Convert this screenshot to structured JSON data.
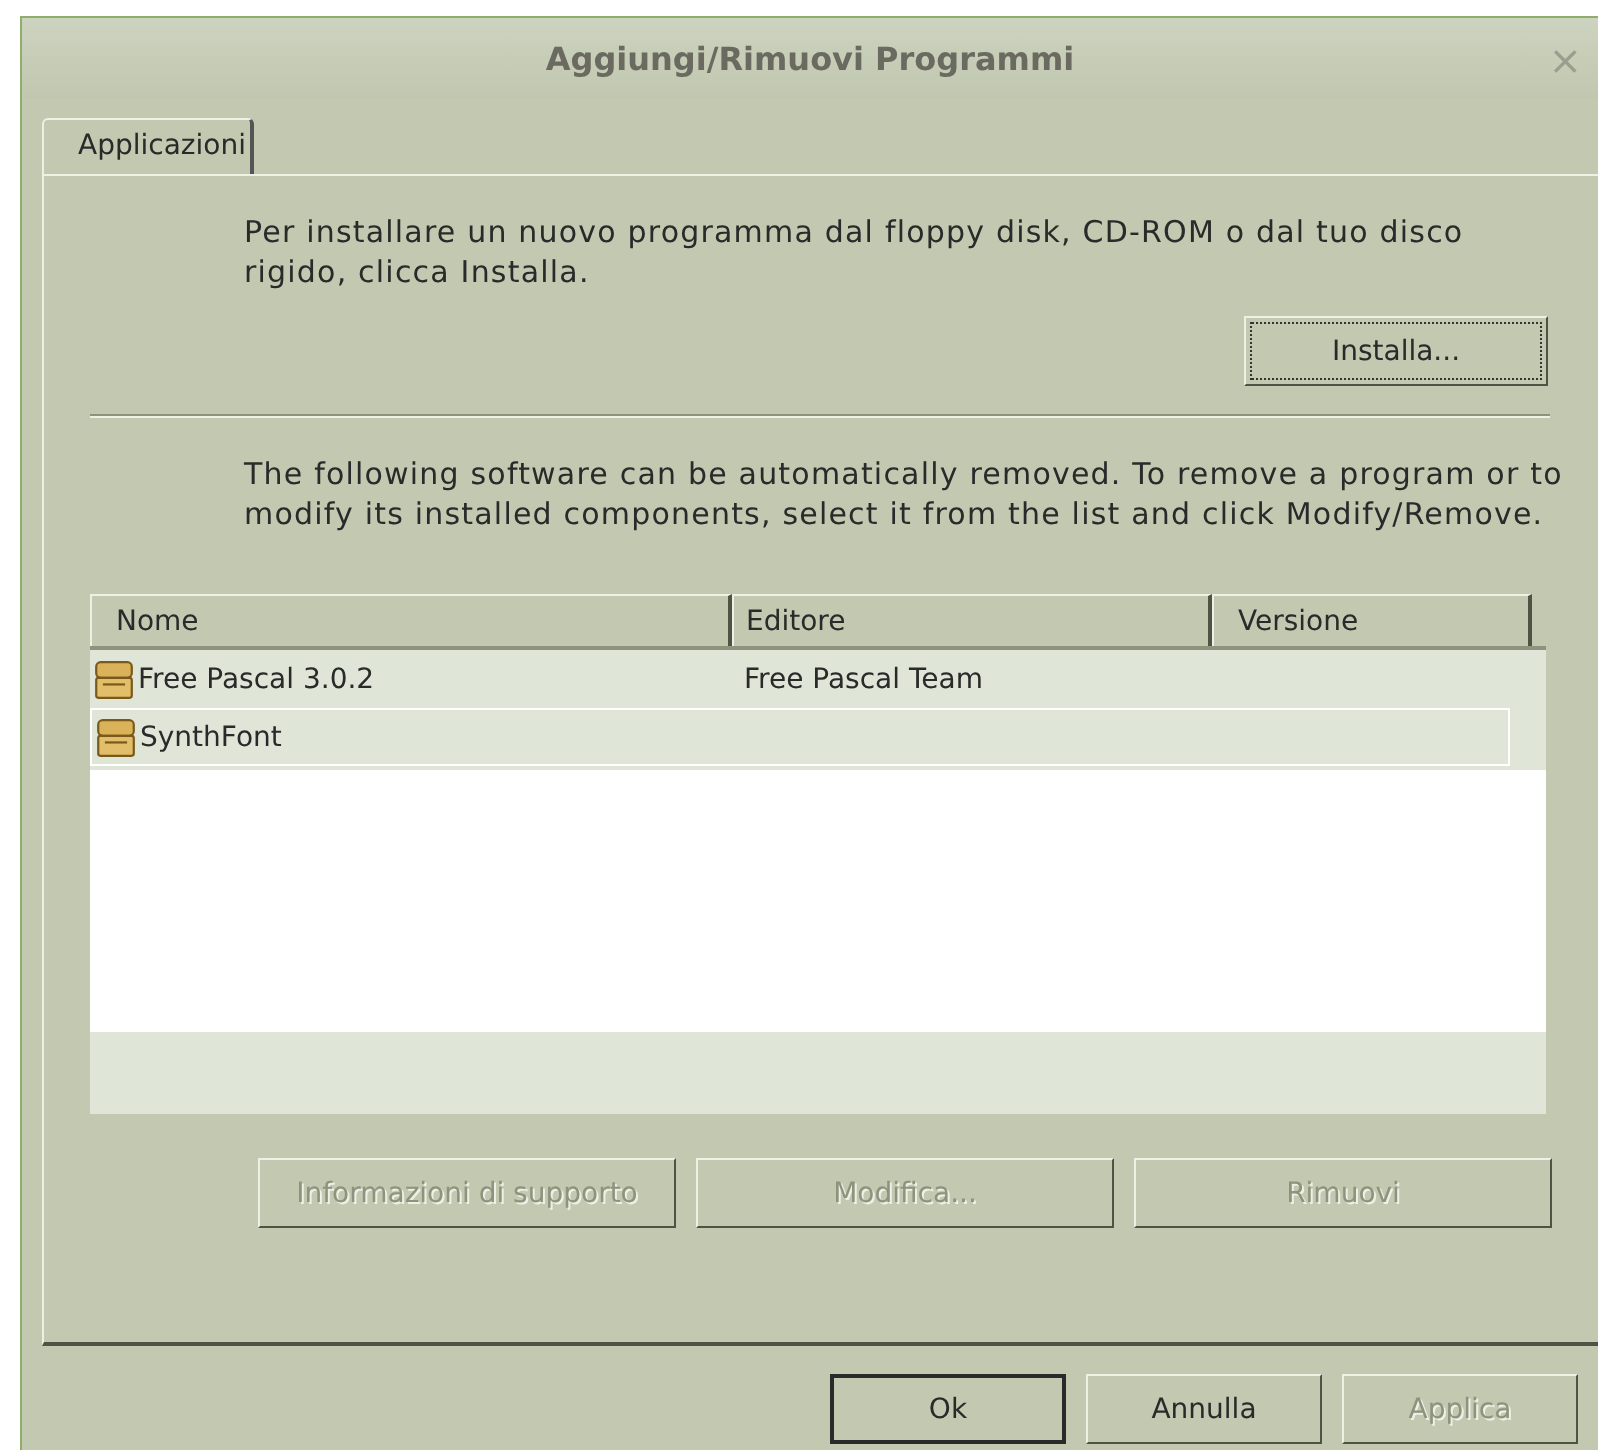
{
  "window": {
    "title": "Aggiungi/Rimuovi Programmi",
    "close": "×"
  },
  "tabs": [
    {
      "label": "Applicazioni",
      "selected": true
    }
  ],
  "install_text": "Per installare un nuovo programma dal floppy disk, CD-ROM o dal tuo disco rigido, clicca Installa.",
  "install_button": {
    "label": "Installa...",
    "disabled": false
  },
  "remove_text": "The following software can be automatically removed. To remove a program or to modify its installed components, select it from the list and click Modify/Remove.",
  "table": {
    "columns": [
      "Nome",
      "Editore",
      "Versione"
    ],
    "rows": [
      {
        "cells": [
          "Free Pascal 3.0.2",
          "Free Pascal Team",
          ""
        ],
        "focused": false
      },
      {
        "cells": [
          "SynthFont",
          "",
          ""
        ],
        "focused": true
      }
    ]
  },
  "action_buttons": [
    {
      "label": "Informazioni di supporto",
      "disabled": true
    },
    {
      "label": "Modifica...",
      "disabled": true
    },
    {
      "label": "Rimuovi",
      "disabled": true
    }
  ],
  "dialog_buttons": [
    {
      "label": "Ok",
      "disabled": false,
      "default": true
    },
    {
      "label": "Annulla",
      "disabled": false,
      "default": false
    },
    {
      "label": "Applica",
      "disabled": true,
      "default": false
    }
  ]
}
